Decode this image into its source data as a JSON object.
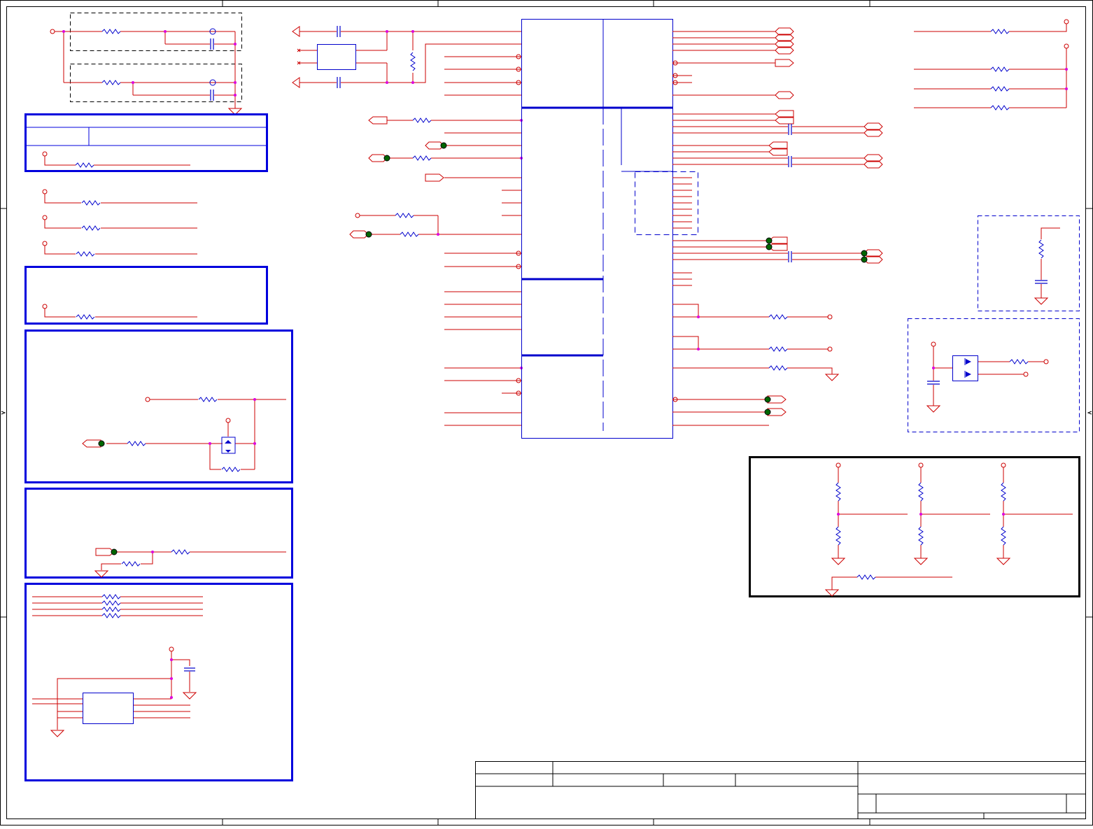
{
  "sheet": {
    "colors": {
      "wire": "#cc0000",
      "pin_end": "#cc0000",
      "junction": "#dd00dd",
      "component": "#0000cc",
      "box": "#0000dd",
      "frame": "#000000",
      "port_fill": "#006600"
    },
    "icons": [
      "resistor-icon",
      "capacitor-icon",
      "crystal-icon",
      "ground-icon",
      "power-pin-icon",
      "port-arrow-icon",
      "mosfet-icon",
      "diode-icon",
      "junction-dot-icon"
    ],
    "title_block": {}
  }
}
